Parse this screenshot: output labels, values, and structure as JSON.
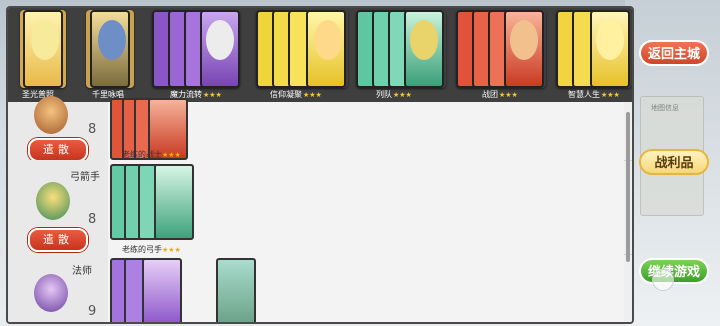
{
  "top_cards": [
    {
      "name": "圣光普照",
      "stars": ""
    },
    {
      "name": "千里咏唱",
      "stars": ""
    },
    {
      "name": "魔力流转",
      "stars": "★★★"
    },
    {
      "name": "信仰凝聚",
      "stars": "★★★"
    },
    {
      "name": "列队",
      "stars": "★★★"
    },
    {
      "name": "战团",
      "stars": "★★★"
    },
    {
      "name": "智慧人生",
      "stars": "★★★"
    }
  ],
  "units": [
    {
      "name": "",
      "count": "8",
      "dismiss_label": "遣散",
      "card_name": "老练的战士",
      "card_stars": "★★★"
    },
    {
      "name": "弓箭手",
      "count": "8",
      "dismiss_label": "遣散",
      "card_name": "老练的弓手",
      "card_stars": "★★★"
    },
    {
      "name": "法师",
      "count": "9",
      "dismiss_label": "",
      "card_name": "",
      "card_stars": ""
    }
  ],
  "side_buttons": {
    "return_city": "返回主城",
    "spoils": "战利品",
    "continue_game": "继续游戏"
  },
  "background": {
    "map_label": "地图信息"
  },
  "colors": {
    "red_button": "#d0452a",
    "yellow_button": "#f6d878",
    "green_button": "#3c9e2a",
    "star": "#f7c62f"
  }
}
